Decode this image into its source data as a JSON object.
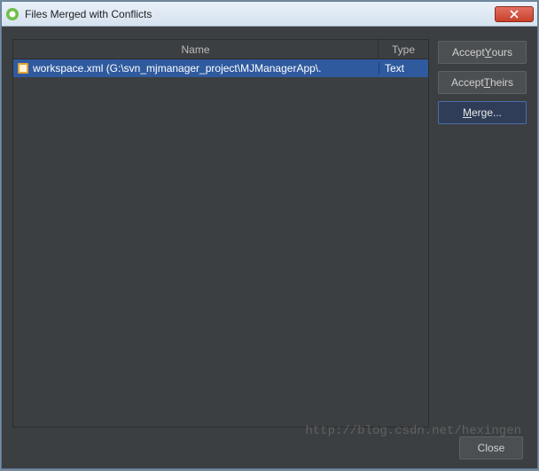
{
  "window": {
    "title": "Files Merged with Conflicts"
  },
  "list": {
    "headers": {
      "name": "Name",
      "type": "Type"
    },
    "rows": [
      {
        "name": "workspace.xml (G:\\svn_mjmanager_project\\MJManagerApp\\.",
        "type": "Text",
        "selected": true
      }
    ]
  },
  "buttons": {
    "accept_yours_pre": "Accept ",
    "accept_yours_u": "Y",
    "accept_yours_post": "ours",
    "accept_theirs_pre": "Accept ",
    "accept_theirs_u": "T",
    "accept_theirs_post": "heirs",
    "merge_u": "M",
    "merge_post": "erge...",
    "close": "Close"
  },
  "watermark": "http://blog.csdn.net/hexingen"
}
